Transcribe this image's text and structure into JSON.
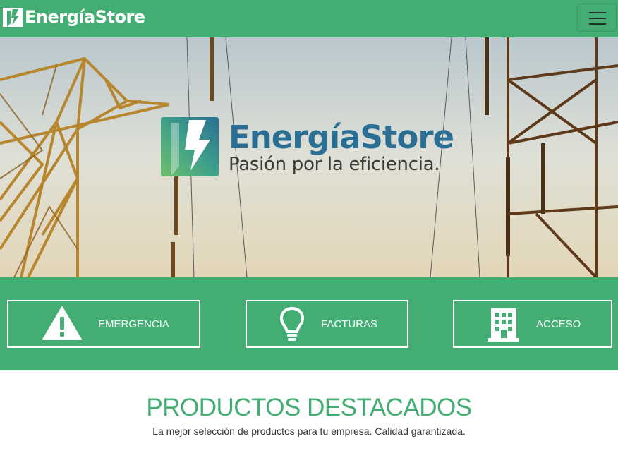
{
  "navbar": {
    "brand": "EnergíaStore",
    "menu_icon": "hamburger-menu-icon"
  },
  "hero": {
    "title": "EnergíaStore",
    "tagline": "Pasión por la eficiencia.",
    "background": "power-transmission-towers-photo"
  },
  "actions": [
    {
      "label": "EMERGENCIA",
      "icon": "warning-triangle-icon"
    },
    {
      "label": "FACTURAS",
      "icon": "lightbulb-icon"
    },
    {
      "label": "ACCESO",
      "icon": "building-icon"
    }
  ],
  "products": {
    "title": "PRODUCTOS DESTACADOS",
    "subtitle": "La mejor selección de productos para tu empresa. Calidad garantizada."
  },
  "colors": {
    "brand_green": "#44ad74",
    "brand_blue": "#2a6f93",
    "white": "#ffffff"
  }
}
